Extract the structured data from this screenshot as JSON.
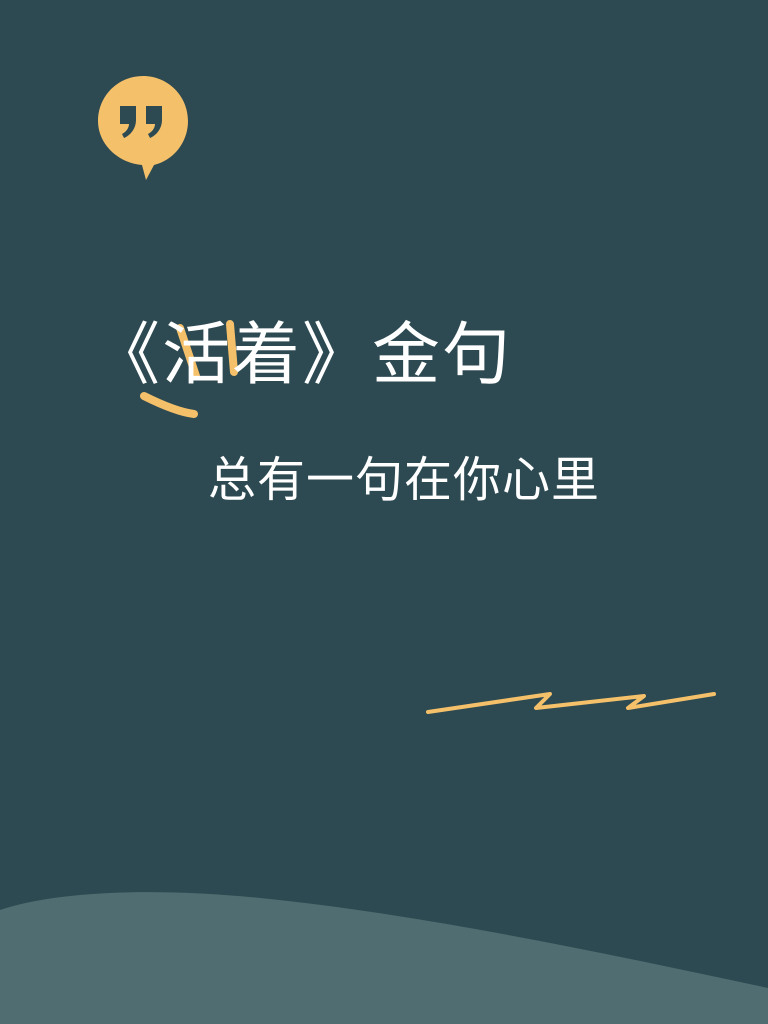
{
  "poster": {
    "title": "《活着》金句",
    "subtitle": "总有一句在你心里"
  },
  "icons": {
    "quote_badge": "quote-bubble-icon"
  },
  "colors": {
    "background": "#2d4a52",
    "accent": "#f5c06a",
    "text": "#ffffff",
    "hill": "#506d71"
  }
}
